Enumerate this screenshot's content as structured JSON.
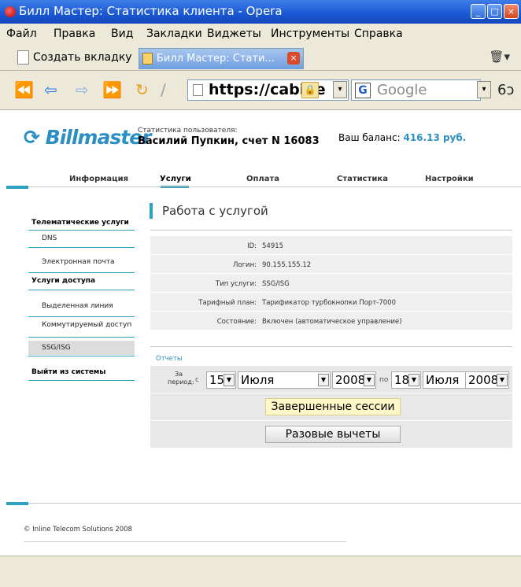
{
  "window": {
    "title": "Билл Мастер: Статистика клиента - Opera",
    "controls": [
      "_",
      "□",
      "×"
    ]
  },
  "menu": [
    "Файл",
    "Правка",
    "Вид",
    "Закладки",
    "Виджеты",
    "Инструменты",
    "Справка"
  ],
  "tabs": {
    "new_tab": "Создать вкладку",
    "active_tab": "Билл Мастер: Стати...",
    "close": "×"
  },
  "nav": {
    "url": "https://cabine",
    "search_engine": "Google",
    "search_icon_letter": "G"
  },
  "page": {
    "logo": "Billmaster",
    "user_label": "Статистика пользователя:",
    "user": "Василий Пупкин, счет N 16083",
    "balance_label": "Ваш баланс:",
    "balance_value": "416.13 руб.",
    "topnav": [
      "Информация",
      "Услуги",
      "Оплата",
      "Статистика",
      "Настройки"
    ],
    "sidebar": {
      "telematic": "Телематические услуги",
      "dns": "DNS",
      "email": "Электронная почта",
      "access": "Услуги доступа",
      "leased": "Выделенная линия",
      "dialup": "Коммутируемый доступ",
      "ssg": "SSG/ISG",
      "logout": "Выйти из системы"
    },
    "title": "Работа с услугой",
    "info": [
      {
        "label": "ID:",
        "value": "54915"
      },
      {
        "label": "Логин:",
        "value": "90.155.155.12"
      },
      {
        "label": "Тип услуги:",
        "value": "SSG/ISG"
      },
      {
        "label": "Тарифный план:",
        "value": "Тарификатор турбокнопки Порт-7000"
      },
      {
        "label": "Состояние:",
        "value": "Включен (автоматическое управление)"
      }
    ],
    "reports_label": "Отчеты",
    "period": {
      "label": "За период:",
      "from": "с",
      "from_day": "15",
      "from_month": "Июля",
      "from_year": "2008",
      "to": "по",
      "to_day": "18",
      "to_month": "Июля",
      "to_year": "2008"
    },
    "buttons": {
      "finished_sessions": "Завершенные сессии",
      "one_time": "Разовые вычеты"
    },
    "footer": "© Inline Telecom Solutions 2008"
  }
}
